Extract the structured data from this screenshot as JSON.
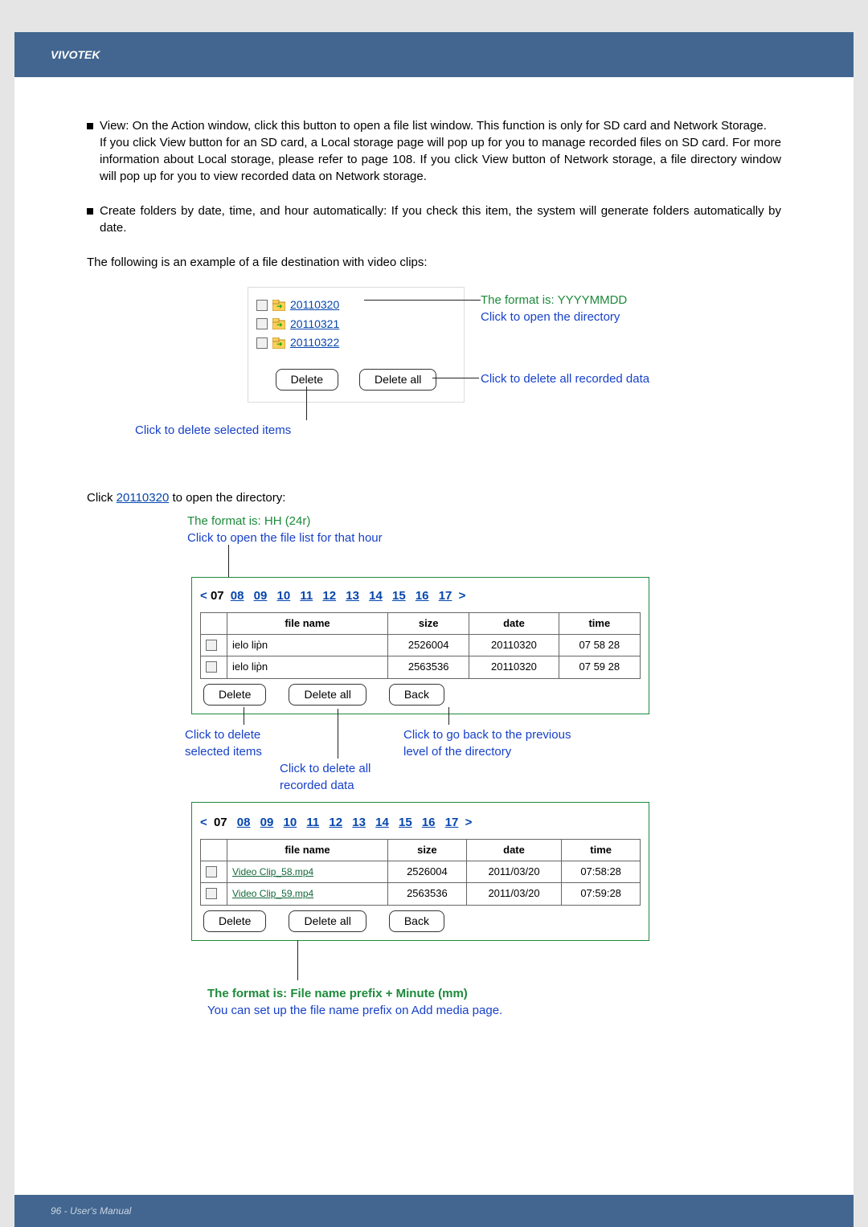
{
  "header": {
    "brand": "VIVOTEK"
  },
  "intro": {
    "view_label": "View: ",
    "view_text": "On the Action window, click this button to open a file list window. This function is only for SD card and Network Storage.",
    "view_text2": "If you click View button for an SD card, a Local storage page will pop up for you to manage recorded files on SD card. For more information about Local storage, please refer to page 108. If you click View button of Network storage, a file directory window will pop up for you to view recorded data on Network storage.",
    "create_label": "Create folders by date, time, and hour automatically: ",
    "create_text": "If you check this item, the system will generate folders automatically by date.",
    "example_intro": "The following is an example of a file destination with video clips:"
  },
  "ss1": {
    "folders": [
      "20110320",
      "20110321",
      "20110322"
    ],
    "delete": "Delete",
    "delete_all": "Delete all",
    "callout_format": "The format is: YYYYMMDD",
    "callout_open": "Click to open the directory",
    "callout_deleteall": "Click to delete all recorded data",
    "callout_delsel": "Click to delete selected items"
  },
  "mid": {
    "click_pre": "Click ",
    "click_link": "20110320",
    "click_post": " to open the directory:",
    "top_annot1": "The format is: HH (24r)",
    "top_annot2": "Click to open the file list for that hour"
  },
  "hourbar": {
    "prev": "<",
    "cur": "07",
    "hours": [
      "08",
      "09",
      "10",
      "11",
      "12",
      "13",
      "14",
      "15",
      "16",
      "17"
    ],
    "next": ">"
  },
  "table_headers": {
    "filename": "file name",
    "size": "size",
    "date": "date",
    "time": "time"
  },
  "ss2_rows": [
    {
      "name": "ielo lip̀n",
      "size": "2526004",
      "date": "20110320",
      "t1": "07",
      "t2": "58",
      "t3": "28"
    },
    {
      "name": "ielo lip̀n",
      "size": "2563536",
      "date": "20110320",
      "t1": "07",
      "t2": "59",
      "t3": "28"
    }
  ],
  "ss2": {
    "delete": "Delete",
    "delete_all": "Delete all",
    "back": "Back",
    "annot_del": "Click to delete selected items",
    "annot_back1": "Click to go back to the previous",
    "annot_back2": "level of the directory",
    "annot_delall1": "Click to delete all",
    "annot_delall2": "recorded data"
  },
  "ss3_rows": [
    {
      "name": "Video Clip_58.mp4",
      "size": "2526004",
      "date": "2011/03/20",
      "time": "07:58:28"
    },
    {
      "name": "Video Clip_59.mp4",
      "size": "2563536",
      "date": "2011/03/20",
      "time": "07:59:28"
    }
  ],
  "ss3": {
    "delete": "Delete",
    "delete_all": "Delete all",
    "back": "Back",
    "annot1": "The format is: File name prefix + Minute (mm)",
    "annot2": "You can set up the file name prefix on Add media page."
  },
  "footer": {
    "text": "96 - User's Manual"
  }
}
